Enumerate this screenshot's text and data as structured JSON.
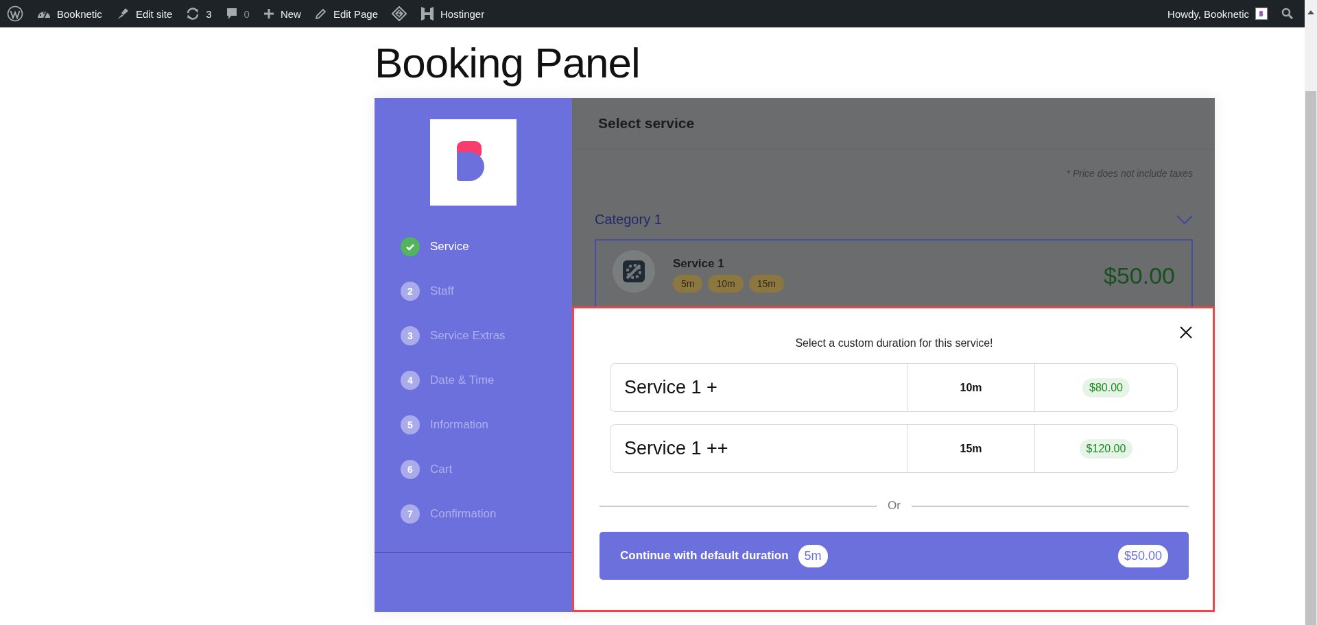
{
  "admin_bar": {
    "items": [
      {
        "kind": "wp-logo"
      },
      {
        "kind": "site",
        "label": "Booknetic"
      },
      {
        "kind": "edit-site",
        "label": "Edit site"
      },
      {
        "kind": "updates",
        "label": "3"
      },
      {
        "kind": "comments",
        "label": "0"
      },
      {
        "kind": "new",
        "label": "New"
      },
      {
        "kind": "edit-page",
        "label": "Edit Page"
      },
      {
        "kind": "plugin"
      },
      {
        "kind": "hostinger",
        "label": "Hostinger"
      }
    ],
    "greeting": "Howdy, Booknetic"
  },
  "page_title": "Booking Panel",
  "steps": [
    {
      "label": "Service",
      "completed": true
    },
    {
      "number": "2",
      "label": "Staff",
      "completed": false
    },
    {
      "number": "3",
      "label": "Service Extras",
      "completed": false
    },
    {
      "number": "4",
      "label": "Date & Time",
      "completed": false
    },
    {
      "number": "5",
      "label": "Information",
      "completed": false
    },
    {
      "number": "6",
      "label": "Cart",
      "completed": false
    },
    {
      "number": "7",
      "label": "Confirmation",
      "completed": false
    }
  ],
  "main": {
    "title": "Select service",
    "note": "* Price does not include taxes",
    "category": "Category 1",
    "service": {
      "name": "Service 1",
      "durations": [
        "5m",
        "10m",
        "15m"
      ],
      "price": "$50.00",
      "selected": true
    }
  },
  "modal": {
    "prompt": "Select a custom duration for this service!",
    "options": [
      {
        "name": "Service 1 +",
        "duration": "10m",
        "price": "$80.00"
      },
      {
        "name": "Service 1 ++",
        "duration": "15m",
        "price": "$120.00"
      }
    ],
    "divider": "Or",
    "default_button": {
      "label": "Continue with default duration",
      "duration": "5m",
      "price": "$50.00"
    }
  }
}
